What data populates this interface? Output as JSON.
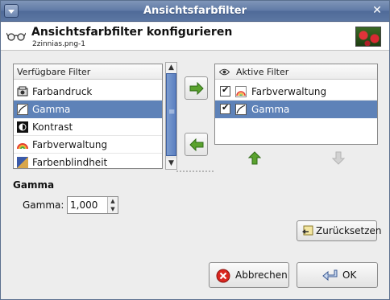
{
  "window": {
    "title": "Ansichtsfarbfilter",
    "close_glyph": "✕"
  },
  "header": {
    "title": "Ansichtsfarbfilter konfigurieren",
    "subtitle": "2zinnias.png-1"
  },
  "available_filters": {
    "column_header": "Verfügbare Filter",
    "items": [
      {
        "label": "Farbandruck",
        "icon": "proof-icon",
        "selected": false
      },
      {
        "label": "Gamma",
        "icon": "gamma-curve-icon",
        "selected": true
      },
      {
        "label": "Kontrast",
        "icon": "contrast-icon",
        "selected": false
      },
      {
        "label": "Farbverwaltung",
        "icon": "color-management-icon",
        "selected": false
      },
      {
        "label": "Farbenblindheit",
        "icon": "color-deficiency-icon",
        "selected": false
      }
    ]
  },
  "active_filters": {
    "column_header": "Aktive Filter",
    "items": [
      {
        "label": "Farbverwaltung",
        "checked": true,
        "icon": "color-management-icon",
        "selected": false
      },
      {
        "label": "Gamma",
        "checked": true,
        "icon": "gamma-curve-icon",
        "selected": true
      }
    ]
  },
  "settings": {
    "section_title": "Gamma",
    "gamma_label": "Gamma:",
    "gamma_value": "1,000"
  },
  "buttons": {
    "reset": "Zurücksetzen",
    "cancel": "Abbrechen",
    "ok": "OK"
  },
  "colors": {
    "selection": "#5e82b8",
    "titlebar": "#5f7aa6",
    "arrow_green": "#5aa22e",
    "arrow_disabled": "#c8c8c8"
  }
}
